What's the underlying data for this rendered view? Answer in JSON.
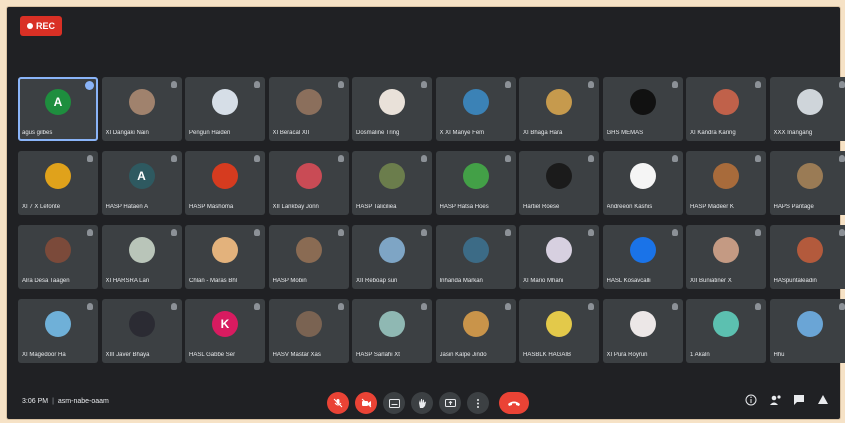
{
  "recording": {
    "label": "REC"
  },
  "participants": [
    {
      "name": "agus gilbes",
      "initial": "A",
      "color": "#1e8e3e",
      "active": true
    },
    {
      "name": "XI Dangaki Nain",
      "initial": "",
      "color": "#a0826d"
    },
    {
      "name": "Pengun Haiden",
      "initial": "",
      "color": "#d6dee7"
    },
    {
      "name": "XI Beracal XII",
      "initial": "",
      "color": "#8b6f5c"
    },
    {
      "name": "Dosmaline Tring",
      "initial": "",
      "color": "#e9e1d9"
    },
    {
      "name": "X XI Manye Fem",
      "initial": "",
      "color": "#3b82b6"
    },
    {
      "name": "XI Bhaga Hara",
      "initial": "",
      "color": "#c69a4d"
    },
    {
      "name": "GHS MEMAS",
      "initial": "",
      "color": "#111111"
    },
    {
      "name": "XI Kandra Karing",
      "initial": "",
      "color": "#c0614a"
    },
    {
      "name": "XXX Inangang",
      "initial": "",
      "color": "#cfd5da"
    },
    {
      "name": "XI 7 X Lefonte",
      "initial": "",
      "color": "#e0a21b"
    },
    {
      "name": "HASP Hataen A",
      "initial": "A",
      "color": "#2e5960"
    },
    {
      "name": "HASP Mashoma",
      "initial": "",
      "color": "#d63b1f"
    },
    {
      "name": "XII Lankbay Jonn",
      "initial": "",
      "color": "#c94b55"
    },
    {
      "name": "HASP Taliciliea",
      "initial": "",
      "color": "#6b7d4c"
    },
    {
      "name": "HASP Hatsa Hoes",
      "initial": "",
      "color": "#43a047"
    },
    {
      "name": "Hartiel Roese",
      "initial": "",
      "color": "#1b1b1b"
    },
    {
      "name": "Andreeon Kashis",
      "initial": "",
      "color": "#f5f5f5"
    },
    {
      "name": "HASP Madeer K",
      "initial": "",
      "color": "#a86b3b"
    },
    {
      "name": "HAPS Pantage",
      "initial": "",
      "color": "#9a7b55"
    },
    {
      "name": "Alra Desa Taagen",
      "initial": "",
      "color": "#7b4a3a"
    },
    {
      "name": "XI HARSRA Lan",
      "initial": "",
      "color": "#b9c5b9"
    },
    {
      "name": "Chlan - Maras Bhl",
      "initial": "",
      "color": "#e3b27c"
    },
    {
      "name": "HASP Mobin",
      "initial": "",
      "color": "#8a6b53"
    },
    {
      "name": "XII Reboap sun",
      "initial": "",
      "color": "#7ea5c5"
    },
    {
      "name": "Inhanda Markan",
      "initial": "",
      "color": "#3c6b86"
    },
    {
      "name": "XI Mario Mhani",
      "initial": "",
      "color": "#d7d0e0"
    },
    {
      "name": "HASL Kosavcalli",
      "initial": "",
      "color": "#1a73e8"
    },
    {
      "name": "XII Buniatiner X",
      "initial": "",
      "color": "#c49a83"
    },
    {
      "name": "HASpuntaleadin",
      "initial": "",
      "color": "#b35a3c"
    },
    {
      "name": "XI Magedoor Ha",
      "initial": "",
      "color": "#6fb0d8"
    },
    {
      "name": "XIII Javer Bhaya",
      "initial": "",
      "color": "#2b2b33"
    },
    {
      "name": "HASL Gabbe Ser",
      "initial": "K",
      "color": "#d81b60"
    },
    {
      "name": "HASV Mastar Xas",
      "initial": "",
      "color": "#7a6352"
    },
    {
      "name": "HASP Sarlahi Xt",
      "initial": "",
      "color": "#8fb8b3"
    },
    {
      "name": "Jasin Kalpe Jindo",
      "initial": "",
      "color": "#c9944a"
    },
    {
      "name": "HASBLK HAGAIB",
      "initial": "",
      "color": "#e3c94a"
    },
    {
      "name": "XI Pura Royrun",
      "initial": "",
      "color": "#ece7e7"
    },
    {
      "name": "1 Akaln",
      "initial": "",
      "color": "#5cc0b0"
    },
    {
      "name": "Hhu",
      "initial": "",
      "color": "#6aa5d6"
    }
  ],
  "bottom": {
    "time": "3:06 PM",
    "meeting_code": "asm-nabe-oaam"
  }
}
